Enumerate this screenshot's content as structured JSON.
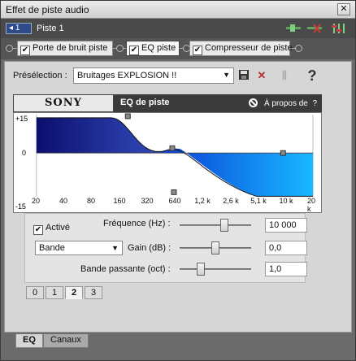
{
  "window": {
    "title": "Effet de piste audio",
    "close_label": "✕"
  },
  "track": {
    "number": "1",
    "name": "Piste 1"
  },
  "chain": {
    "plugins": [
      {
        "label": "Porte de bruit piste",
        "checked": true
      },
      {
        "label": "EQ piste",
        "checked": true,
        "selected": true
      },
      {
        "label": "Compresseur de piste",
        "checked": true
      }
    ]
  },
  "preset": {
    "label": "Présélection :",
    "value": "Bruitages EXPLOSION !!"
  },
  "plugin_header": {
    "brand": "SONY",
    "name": "EQ de piste",
    "about": "À propos de",
    "help": "?"
  },
  "graph": {
    "y_ticks": [
      "+15",
      "0",
      "-15"
    ],
    "x_ticks": [
      "20",
      "40",
      "80",
      "160",
      "320",
      "640",
      "1,2 k",
      "2,6 k",
      "5,1 k",
      "10 k",
      "20 k"
    ],
    "colors": {
      "band_fill_dark": "#0b0f6e",
      "band_fill_light": "#19b8ff",
      "curve": "#222222"
    }
  },
  "controls": {
    "active_label": "Activé",
    "active_checked": true,
    "frequency_label": "Fréquence (Hz) :",
    "frequency_value": "10 000",
    "frequency_level": 0.62,
    "band_type": "Bande",
    "gain_label": "Gain (dB) :",
    "gain_value": "0,0",
    "gain_level": 0.5,
    "bandwidth_label": "Bande passante (oct) :",
    "bandwidth_value": "1,0",
    "bandwidth_level": 0.3
  },
  "band_tabs": [
    "0",
    "1",
    "2",
    "3"
  ],
  "bottom_tabs": [
    "EQ",
    "Canaux"
  ]
}
